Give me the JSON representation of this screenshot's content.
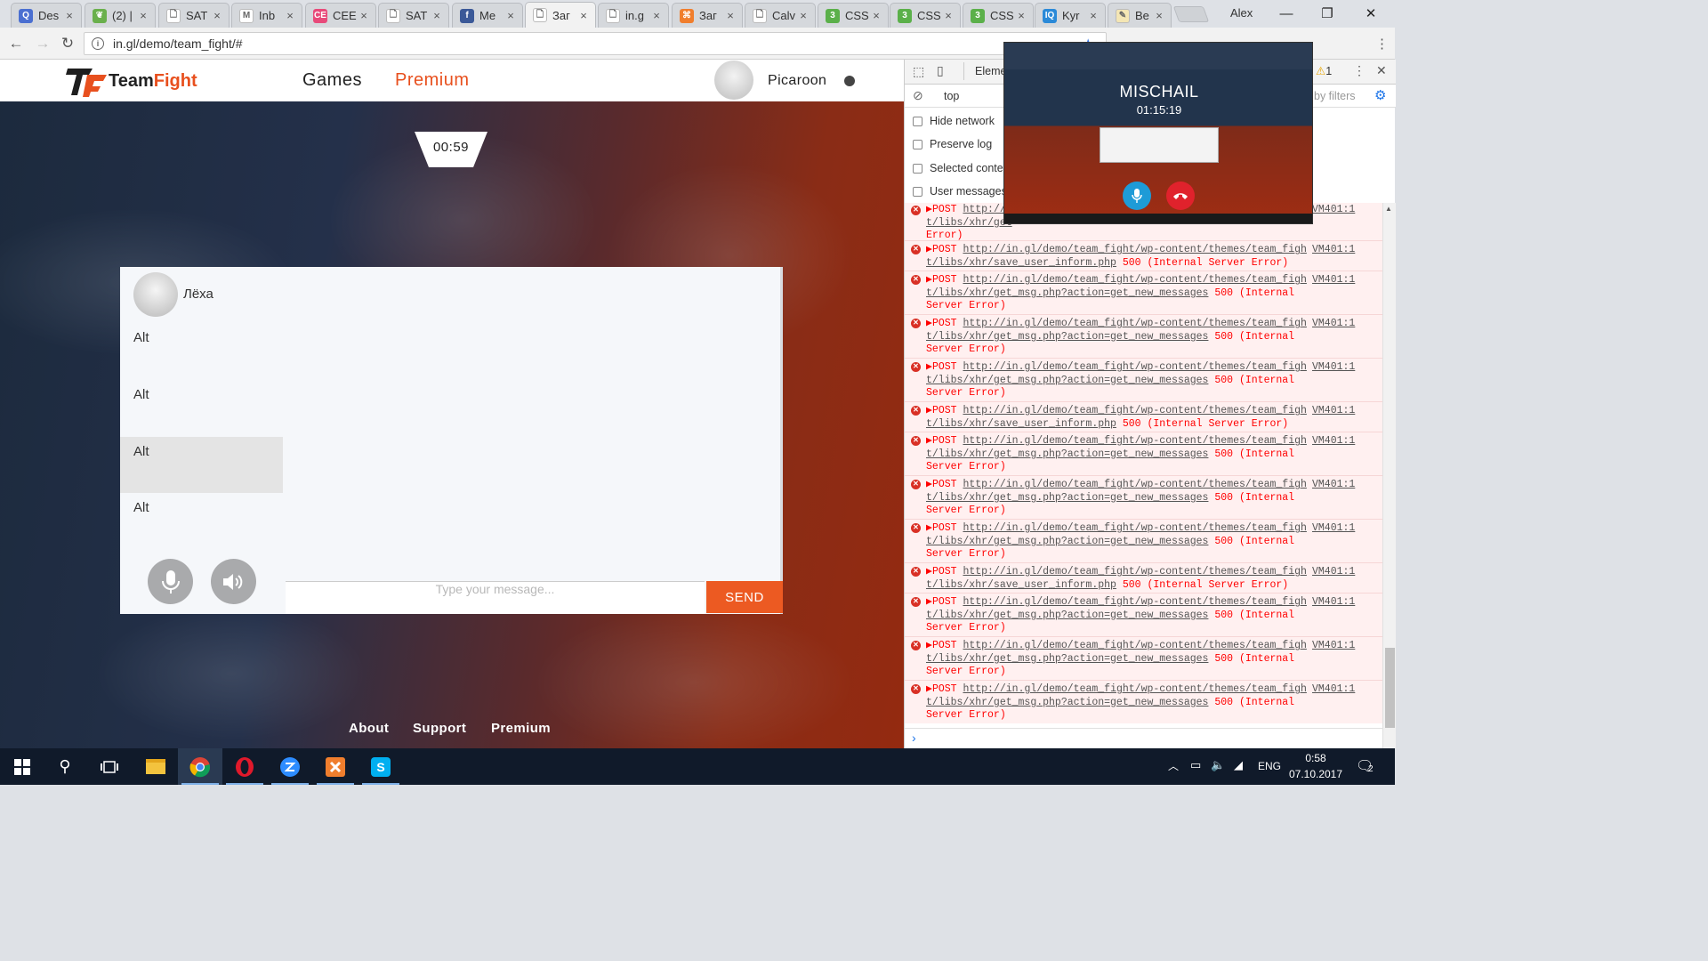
{
  "browser": {
    "tabs": [
      {
        "title": "Des",
        "favicon_color": "#4a6fd1",
        "favicon_glyph": "Q"
      },
      {
        "title": "(2) |",
        "favicon_color": "#6ab04c",
        "favicon_glyph": "❦"
      },
      {
        "title": "SAT",
        "favicon_color": "#ffffff",
        "favicon_glyph": "🗋"
      },
      {
        "title": "Inb",
        "favicon_color": "#ffffff",
        "favicon_glyph": "M"
      },
      {
        "title": "CEE",
        "favicon_color": "#e84a7a",
        "favicon_glyph": "CE"
      },
      {
        "title": "SAT",
        "favicon_color": "#ffffff",
        "favicon_glyph": "🗋"
      },
      {
        "title": "Me",
        "favicon_color": "#3b5998",
        "favicon_glyph": "f"
      },
      {
        "title": "Заг",
        "favicon_color": "#ffffff",
        "favicon_glyph": "🗋",
        "active": true
      },
      {
        "title": "in.g",
        "favicon_color": "#ffffff",
        "favicon_glyph": "🗋"
      },
      {
        "title": "Заг",
        "favicon_color": "#f07e2d",
        "favicon_glyph": "⌘"
      },
      {
        "title": "Calv",
        "favicon_color": "#ffffff",
        "favicon_glyph": "🗋"
      },
      {
        "title": "CSS",
        "favicon_color": "#5bb04a",
        "favicon_glyph": "3"
      },
      {
        "title": "CSS",
        "favicon_color": "#5bb04a",
        "favicon_glyph": "3"
      },
      {
        "title": "CSS",
        "favicon_color": "#5bb04a",
        "favicon_glyph": "3"
      },
      {
        "title": "Kyr",
        "favicon_color": "#2b8ad8",
        "favicon_glyph": "IQ"
      },
      {
        "title": "Ве",
        "favicon_color": "#f4e6b4",
        "favicon_glyph": "✎"
      }
    ],
    "window_user": "Alex",
    "url": "in.gl/demo/team_fight/#"
  },
  "site": {
    "brand_prefix": "Team",
    "brand_suffix": "Fight",
    "nav": [
      {
        "label": "Games",
        "color": "#222222"
      },
      {
        "label": "Premium",
        "color": "#e8501e"
      }
    ],
    "username": "Picaroon",
    "timer": "00:59",
    "chat": {
      "partner_name": "Лёха",
      "contacts": [
        "Alt",
        "Alt",
        "Alt",
        "Alt"
      ],
      "selected_contact_index": 2,
      "input_placeholder": "Type your message...",
      "send_label": "SEND"
    },
    "footer_links": [
      "About",
      "Support",
      "Premium"
    ]
  },
  "devtools": {
    "tab_label": "Eleme",
    "context": "top",
    "filter_placeholder": "by filters",
    "warning_count": "1",
    "options": [
      "Hide network",
      "Preserve log",
      "Selected contex",
      "User messages o"
    ],
    "partial_entry": {
      "method": "POST",
      "url_start": "http://",
      "url_rest": "t/libs/xhr/get",
      "status_tail": "Error)",
      "source": "VM401:1"
    },
    "entries": [
      {
        "method": "POST",
        "url1": "http://in.gl/demo/team_fight/wp-content/themes/team_figh",
        "url2": "t/libs/xhr/save_user_inform.php",
        "status": "500 (Internal Server Error)",
        "source": "VM401:1"
      },
      {
        "method": "POST",
        "url1": "http://in.gl/demo/team_fight/wp-content/themes/team_figh",
        "url2": "t/libs/xhr/get_msg.php?action=get_new_messages",
        "status": "500 (Internal Server Error)",
        "source": "VM401:1"
      },
      {
        "method": "POST",
        "url1": "http://in.gl/demo/team_fight/wp-content/themes/team_figh",
        "url2": "t/libs/xhr/get_msg.php?action=get_new_messages",
        "status": "500 (Internal Server Error)",
        "source": "VM401:1"
      },
      {
        "method": "POST",
        "url1": "http://in.gl/demo/team_fight/wp-content/themes/team_figh",
        "url2": "t/libs/xhr/get_msg.php?action=get_new_messages",
        "status": "500 (Internal Server Error)",
        "source": "VM401:1"
      },
      {
        "method": "POST",
        "url1": "http://in.gl/demo/team_fight/wp-content/themes/team_figh",
        "url2": "t/libs/xhr/save_user_inform.php",
        "status": "500 (Internal Server Error)",
        "source": "VM401:1"
      },
      {
        "method": "POST",
        "url1": "http://in.gl/demo/team_fight/wp-content/themes/team_figh",
        "url2": "t/libs/xhr/get_msg.php?action=get_new_messages",
        "status": "500 (Internal Server Error)",
        "source": "VM401:1"
      },
      {
        "method": "POST",
        "url1": "http://in.gl/demo/team_fight/wp-content/themes/team_figh",
        "url2": "t/libs/xhr/get_msg.php?action=get_new_messages",
        "status": "500 (Internal Server Error)",
        "source": "VM401:1"
      },
      {
        "method": "POST",
        "url1": "http://in.gl/demo/team_fight/wp-content/themes/team_figh",
        "url2": "t/libs/xhr/get_msg.php?action=get_new_messages",
        "status": "500 (Internal Server Error)",
        "source": "VM401:1"
      },
      {
        "method": "POST",
        "url1": "http://in.gl/demo/team_fight/wp-content/themes/team_figh",
        "url2": "t/libs/xhr/save_user_inform.php",
        "status": "500 (Internal Server Error)",
        "source": "VM401:1"
      },
      {
        "method": "POST",
        "url1": "http://in.gl/demo/team_fight/wp-content/themes/team_figh",
        "url2": "t/libs/xhr/get_msg.php?action=get_new_messages",
        "status": "500 (Internal Server Error)",
        "source": "VM401:1"
      },
      {
        "method": "POST",
        "url1": "http://in.gl/demo/team_fight/wp-content/themes/team_figh",
        "url2": "t/libs/xhr/get_msg.php?action=get_new_messages",
        "status": "500 (Internal Server Error)",
        "source": "VM401:1"
      },
      {
        "method": "POST",
        "url1": "http://in.gl/demo/team_fight/wp-content/themes/team_figh",
        "url2": "t/libs/xhr/get_msg.php?action=get_new_messages",
        "status": "500 (Internal Server Error)",
        "source": "VM401:1"
      }
    ]
  },
  "call": {
    "name": "MISCHAIL",
    "duration": "01:15:19"
  },
  "taskbar": {
    "apps": [
      "file-explorer-icon",
      "chrome-icon",
      "opera-icon",
      "zoom-icon",
      "xampp-icon",
      "skype-icon"
    ],
    "language": "ENG",
    "time": "0:58",
    "date": "07.10.2017",
    "notifications": "2"
  }
}
